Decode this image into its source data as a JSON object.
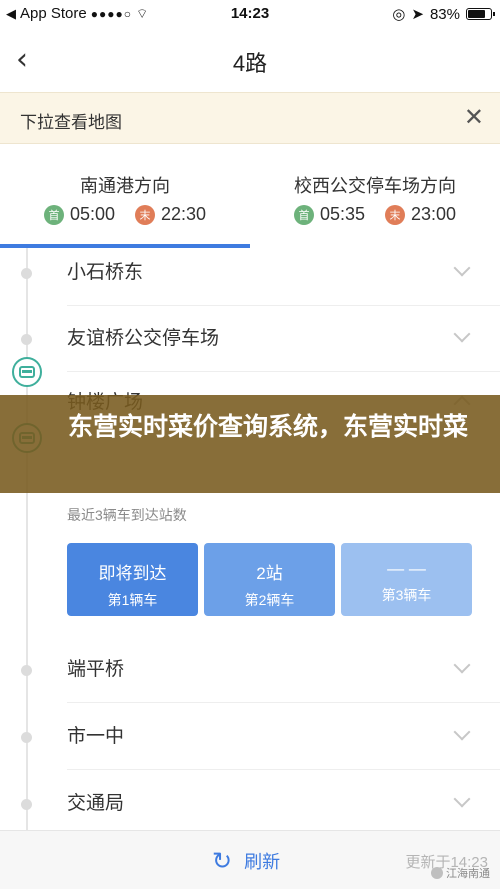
{
  "status_bar": {
    "carrier": "App Store",
    "signal": "●●●●○",
    "time": "14:23",
    "battery": "83%",
    "battery_level": 0.83
  },
  "nav": {
    "back_icon": "chevron-left-icon",
    "title": "4路"
  },
  "banner": {
    "text": "下拉查看地图",
    "close_icon": "close-icon"
  },
  "directions": [
    {
      "name": "南通港方向",
      "first_badge": "首",
      "first_time": "05:00",
      "last_badge": "末",
      "last_time": "22:30",
      "selected": true
    },
    {
      "name": "校西公交停车场方向",
      "first_badge": "首",
      "first_time": "05:35",
      "last_badge": "末",
      "last_time": "23:00",
      "selected": false
    }
  ],
  "stops": [
    {
      "name": "小石桥东"
    },
    {
      "name": "友谊桥公交停车场"
    },
    {
      "name": "钟楼广场"
    },
    {
      "name": "端平桥"
    },
    {
      "name": "市一中"
    },
    {
      "name": "交通局"
    }
  ],
  "overlay": {
    "text": "东营实时菜价查询系统，东营实时菜价查询系统，透明化菜"
  },
  "arrivals": {
    "label": "最近3辆车到达站数",
    "cards": [
      {
        "main": "即将到达",
        "sub": "第1辆车",
        "color": "#4a86e0"
      },
      {
        "main": "2站",
        "sub": "第2辆车",
        "color": "#6ca0e8"
      },
      {
        "main": "— —",
        "sub": "第3辆车",
        "color": "#9cc0f0"
      }
    ]
  },
  "bottom": {
    "refresh_label": "刷新",
    "update_time": "更新于14:23",
    "watermark": "江海南通"
  },
  "colors": {
    "accent": "#3e7be0",
    "first_badge": "#6db27b",
    "last_badge": "#e07d58",
    "banner_bg": "#fbf5e6"
  }
}
